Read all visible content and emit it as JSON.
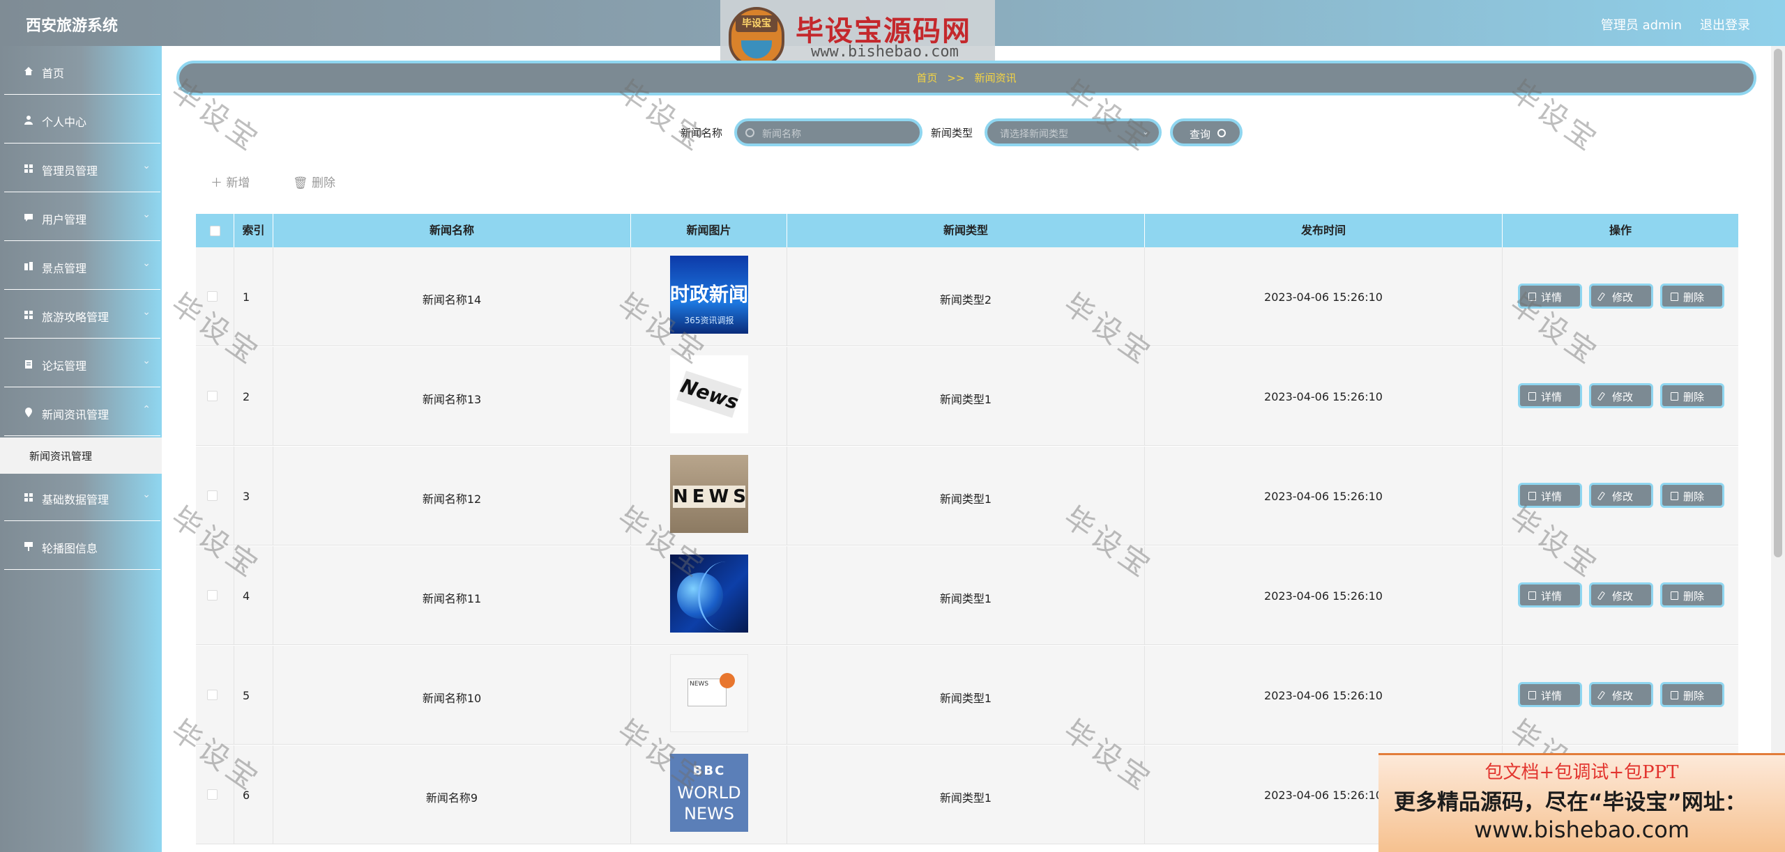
{
  "app": {
    "title": "西安旅游系统",
    "user": "管理员 admin",
    "logout": "退出登录"
  },
  "brand": {
    "logo_text": "毕设宝",
    "name": "毕设宝源码网",
    "url": "www.bishebao.com"
  },
  "sidebar": {
    "items": [
      {
        "label": "首页",
        "icon": "home-icon"
      },
      {
        "label": "个人中心",
        "icon": "user-icon"
      },
      {
        "label": "管理员管理",
        "icon": "grid-icon"
      },
      {
        "label": "用户管理",
        "icon": "chat-icon"
      },
      {
        "label": "景点管理",
        "icon": "building-icon"
      },
      {
        "label": "旅游攻略管理",
        "icon": "grid-icon"
      },
      {
        "label": "论坛管理",
        "icon": "clipboard-icon"
      },
      {
        "label": "新闻资讯管理",
        "icon": "location-icon"
      },
      {
        "label": "基础数据管理",
        "icon": "grid-icon"
      },
      {
        "label": "轮播图信息",
        "icon": "sign-icon"
      }
    ],
    "submenu": {
      "label": "新闻资讯管理"
    }
  },
  "breadcrumb": {
    "home": "首页",
    "separator": ">>",
    "current": "新闻资讯"
  },
  "search": {
    "name_label": "新闻名称",
    "name_placeholder": "新闻名称",
    "type_label": "新闻类型",
    "type_placeholder": "请选择新闻类型",
    "query_button": "查询"
  },
  "toolbar": {
    "add": "新增",
    "delete": "删除"
  },
  "table": {
    "columns": [
      "索引",
      "新闻名称",
      "新闻图片",
      "新闻类型",
      "发布时间",
      "操作"
    ],
    "rows": [
      {
        "index": "1",
        "name": "新闻名称14",
        "type": "新闻类型2",
        "time": "2023-04-06 15:26:10"
      },
      {
        "index": "2",
        "name": "新闻名称13",
        "type": "新闻类型1",
        "time": "2023-04-06 15:26:10"
      },
      {
        "index": "3",
        "name": "新闻名称12",
        "type": "新闻类型1",
        "time": "2023-04-06 15:26:10"
      },
      {
        "index": "4",
        "name": "新闻名称11",
        "type": "新闻类型1",
        "time": "2023-04-06 15:26:10"
      },
      {
        "index": "5",
        "name": "新闻名称10",
        "type": "新闻类型1",
        "time": "2023-04-06 15:26:10"
      },
      {
        "index": "6",
        "name": "新闻名称9",
        "type": "新闻类型1",
        "time": "2023-04-06 15:26:10"
      }
    ],
    "actions": {
      "detail": "详情",
      "edit": "修改",
      "delete": "删除"
    },
    "thumb_texts": {
      "t1_big": "时政新闻",
      "t1_small": "365资讯调报",
      "t2": "News",
      "t3": "NEWS",
      "t5": "NEWS",
      "t6_a": "BBC",
      "t6_b": "WORLD",
      "t6_c": "NEWS"
    }
  },
  "watermark": "毕设宝",
  "ad": {
    "line1": "包文档+包调试+包PPT",
    "line2": "更多精品源码，尽在“毕设宝”网址：",
    "line3": "www.bishebao.com"
  },
  "colors": {
    "accent": "#8fd6f0",
    "control": "#7c8a93",
    "breadcrumb_text": "#f5d442"
  }
}
